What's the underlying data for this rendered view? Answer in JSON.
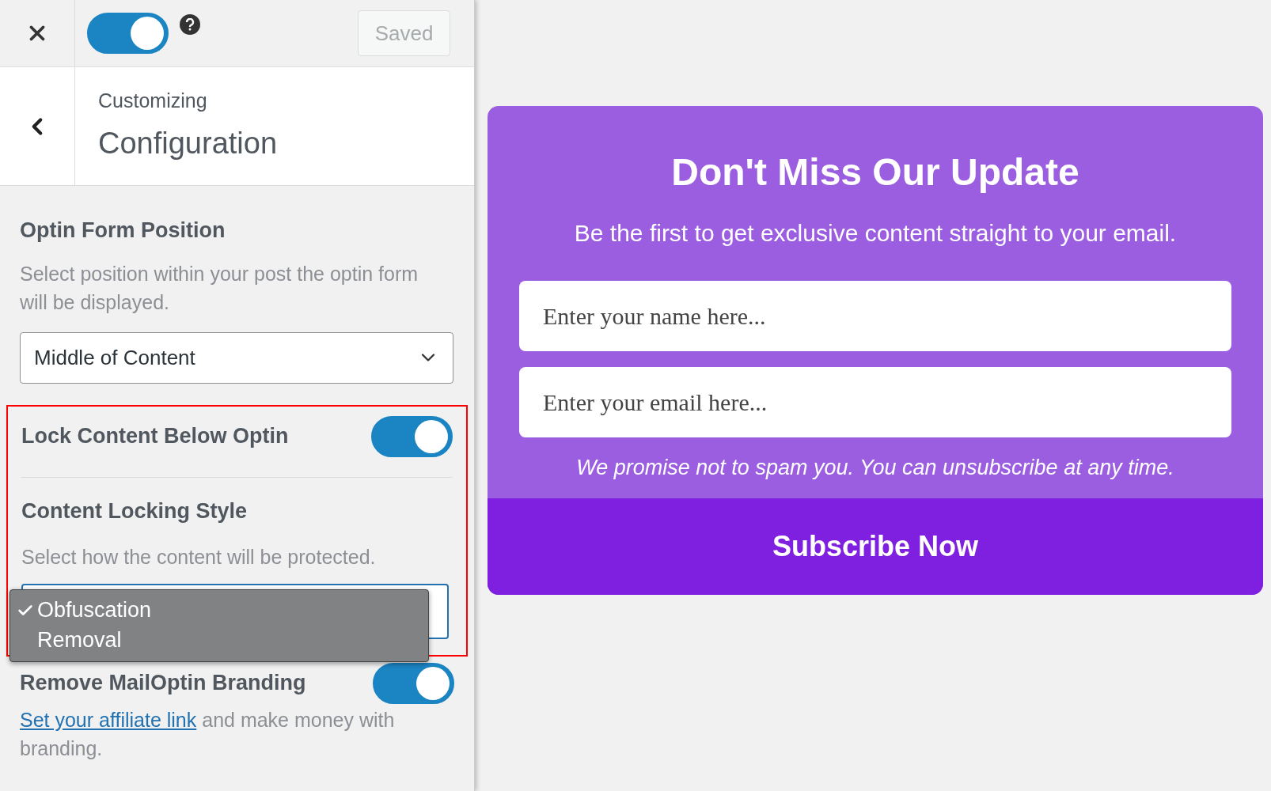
{
  "top_bar": {
    "publish_toggle": {
      "on": true
    },
    "save_button": "Saved"
  },
  "header": {
    "subtitle": "Customizing",
    "title": "Configuration"
  },
  "position_setting": {
    "label": "Optin Form Position",
    "description": "Select position within your post the optin form will be displayed.",
    "value": "Middle of Content"
  },
  "highlight_frame": {
    "shown": true
  },
  "lock_setting": {
    "label": "Lock Content Below Optin",
    "on": true
  },
  "locking_style": {
    "label": "Content Locking Style",
    "description": "Select how the content will be protected.",
    "dropdown_open": true,
    "options": [
      {
        "label": "Obfuscation",
        "selected": true
      },
      {
        "label": "Removal",
        "selected": false
      }
    ]
  },
  "branding_setting": {
    "label": "Remove MailOptin Branding",
    "on": true,
    "link": "Set your affiliate link",
    "text": "and make money with branding."
  },
  "preview": {
    "title": "Don't Miss Our Update",
    "subtitle": "Be the first to get exclusive content straight to your email.",
    "name_placeholder": "Enter your name here...",
    "email_placeholder": "Enter your email here...",
    "note": "We promise not to spam you. You can unsubscribe at any time.",
    "button": "Subscribe Now"
  }
}
